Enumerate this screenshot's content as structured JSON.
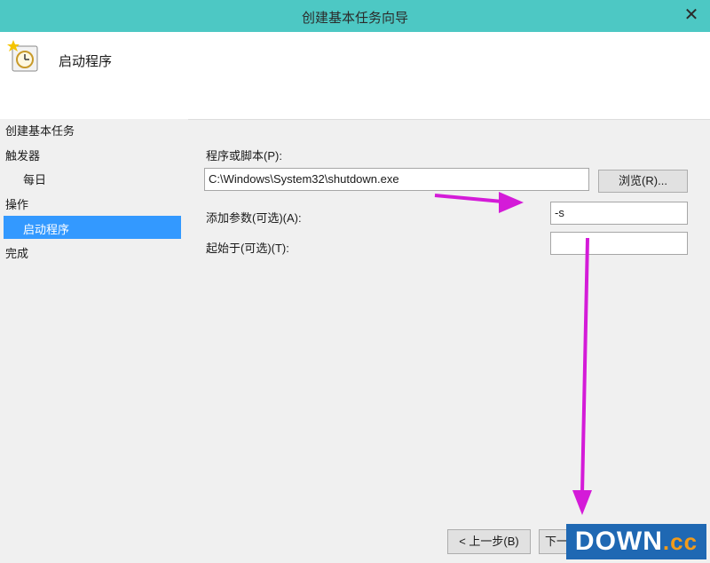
{
  "window": {
    "title": "创建基本任务向导",
    "close_glyph": "✕"
  },
  "header": {
    "heading": "启动程序"
  },
  "nav": {
    "items": [
      {
        "label": "创建基本任务"
      },
      {
        "label": "触发器"
      },
      {
        "label": "每日"
      },
      {
        "label": "操作"
      },
      {
        "label": "启动程序"
      },
      {
        "label": "完成"
      }
    ]
  },
  "form": {
    "program_label": "程序或脚本(P):",
    "program_value": "C:\\Windows\\System32\\shutdown.exe",
    "browse_label": "浏览(R)...",
    "args_label": "添加参数(可选)(A):",
    "args_value": "-s",
    "startin_label": "起始于(可选)(T):",
    "startin_value": ""
  },
  "footer": {
    "back_label": "< 上一步(B)",
    "next_label": "下一"
  },
  "watermark": {
    "text": "DOWN",
    "suffix": ".cc"
  },
  "colors": {
    "titlebar": "#4dc8c4",
    "selection": "#3399ff",
    "annotation_arrow": "#d41bd8"
  }
}
